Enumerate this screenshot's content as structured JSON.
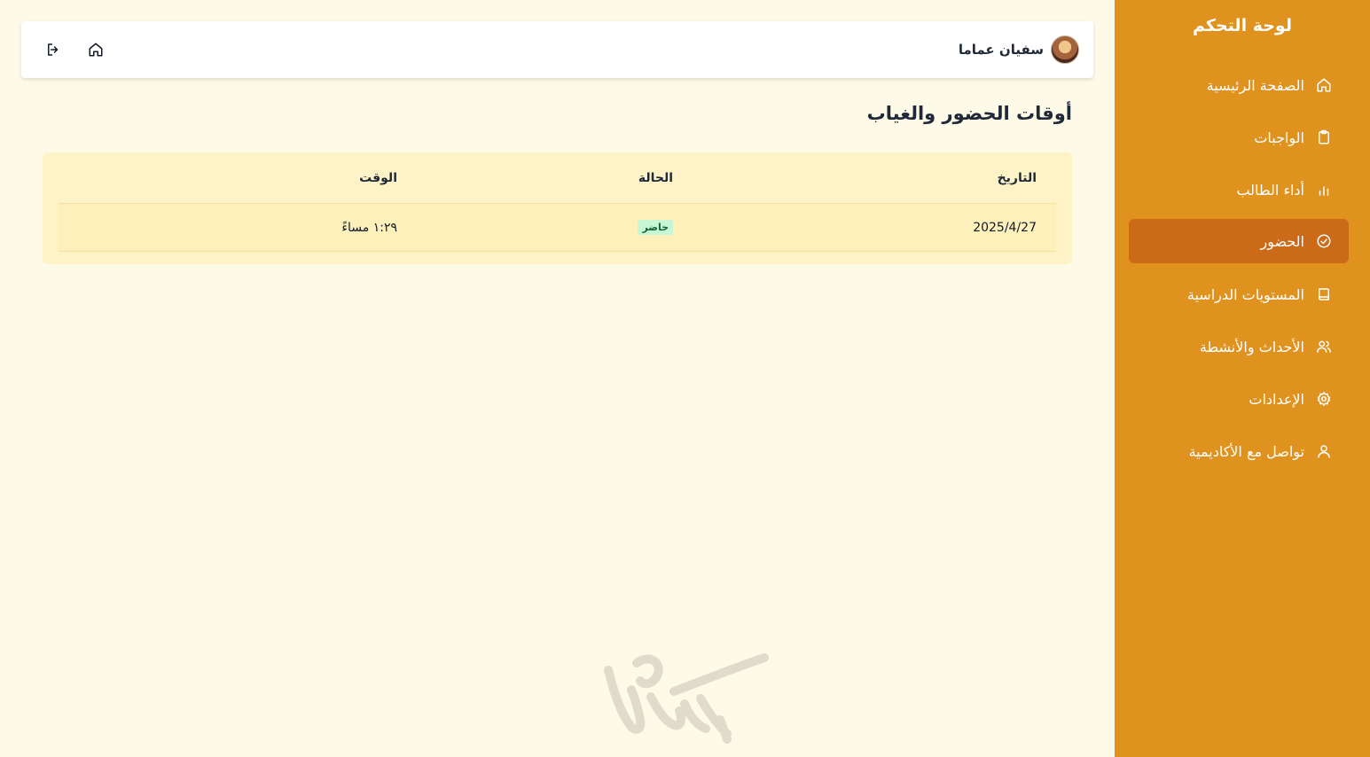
{
  "sidebar": {
    "title": "لوحة التحكم",
    "items": [
      {
        "label": "الصفحة الرئيسية",
        "icon": "home-icon"
      },
      {
        "label": "الواجبات",
        "icon": "clipboard-icon"
      },
      {
        "label": "أداء الطالب",
        "icon": "bar-chart-icon"
      },
      {
        "label": "الحضور",
        "icon": "check-circle-icon",
        "active": true
      },
      {
        "label": "المستويات الدراسية",
        "icon": "book-icon"
      },
      {
        "label": "الأحداث والأنشطة",
        "icon": "users-icon"
      },
      {
        "label": "الإعدادات",
        "icon": "gear-icon"
      },
      {
        "label": "تواصل مع الأكاديمية",
        "icon": "user-icon"
      }
    ]
  },
  "header": {
    "user_name": "سفيان عماما"
  },
  "page": {
    "title": "أوقات الحضور والغياب"
  },
  "table": {
    "columns": {
      "date": "التاريخ",
      "status": "الحالة",
      "time": "الوقت"
    },
    "rows": [
      {
        "date": "2025/4/27",
        "status": "حاضر",
        "time": "١:٢٩ مساءً"
      }
    ]
  },
  "colors": {
    "sidebar_bg": "#e0921f",
    "active_item_bg": "#cb6a18",
    "page_bg": "#fefae8",
    "table_bg": "#fef3c7",
    "badge_bg": "#c6f6d5"
  }
}
